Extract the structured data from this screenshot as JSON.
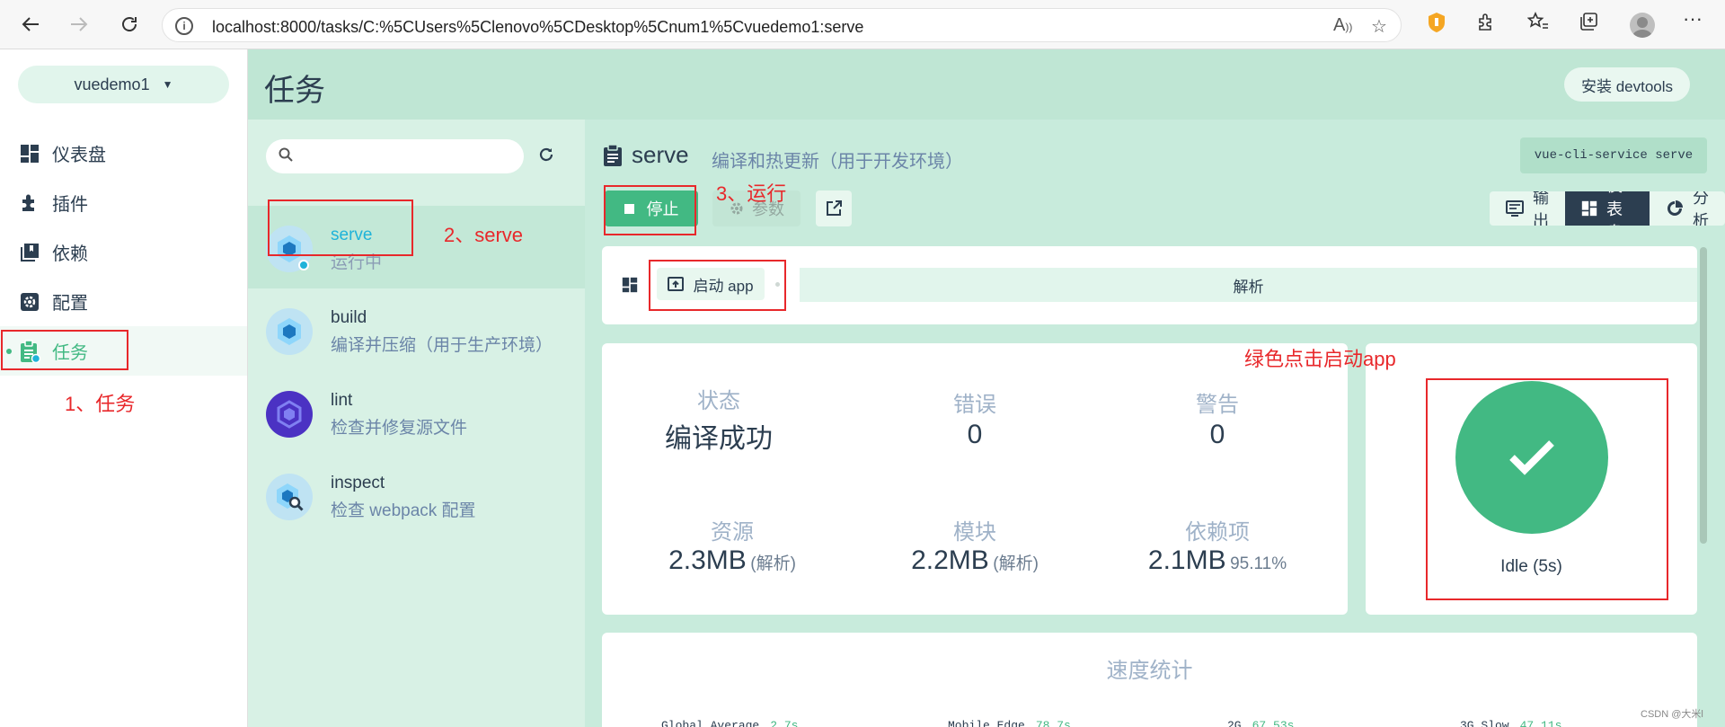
{
  "browser": {
    "url": "localhost:8000/tasks/C:%5CUsers%5Clenovo%5CDesktop%5Cnum1%5Cvuedemo1:serve"
  },
  "sidebar": {
    "project": "vuedemo1",
    "items": [
      {
        "label": "仪表盘",
        "icon": "dashboard-icon"
      },
      {
        "label": "插件",
        "icon": "puzzle-icon"
      },
      {
        "label": "依赖",
        "icon": "library-icon"
      },
      {
        "label": "配置",
        "icon": "gear-icon"
      },
      {
        "label": "任务",
        "icon": "clipboard-icon",
        "active": true
      }
    ]
  },
  "header": {
    "title": "任务",
    "devtools_button": "安装 devtools"
  },
  "task_list": {
    "search_placeholder": "",
    "tasks": [
      {
        "name": "serve",
        "description": "运行中",
        "selected": true
      },
      {
        "name": "build",
        "description": "编译并压缩（用于生产环境）"
      },
      {
        "name": "lint",
        "description": "检查并修复源文件"
      },
      {
        "name": "inspect",
        "description": "检查 webpack 配置"
      }
    ]
  },
  "detail": {
    "title": "serve",
    "description": "编译和热更新（用于开发环境）",
    "command": "vue-cli-service serve",
    "stop_button": "停止",
    "params_button": "参数",
    "tabs": [
      {
        "label": "输出",
        "icon": "terminal-icon"
      },
      {
        "label": "仪表盘",
        "icon": "dashboard-icon",
        "active": true
      },
      {
        "label": "分析",
        "icon": "pie-icon"
      }
    ],
    "launch_button": "启动 app",
    "analyze_label": "解析",
    "stats": {
      "status_label": "状态",
      "status_value": "编译成功",
      "errors_label": "错误",
      "errors_value": "0",
      "warnings_label": "警告",
      "warnings_value": "0",
      "assets_label": "资源",
      "assets_value": "2.3MB",
      "assets_sub": "(解析)",
      "modules_label": "模块",
      "modules_value": "2.2MB",
      "modules_sub": "(解析)",
      "deps_label": "依赖项",
      "deps_value": "2.1MB",
      "deps_sub": "95.11%"
    },
    "idle_status": "Idle (5s)",
    "speed_title": "速度统计",
    "speed": [
      {
        "label": "Global Average",
        "value": "2.7s"
      },
      {
        "label": "Mobile Edge",
        "value": "78.7s"
      },
      {
        "label": "2G",
        "value": "67.53s"
      },
      {
        "label": "3G Slow",
        "value": "47.11s"
      }
    ]
  },
  "annotations": {
    "a1": "1、任务",
    "a2": "2、serve",
    "a3": "3、运行",
    "a4": "绿色点击启动app"
  },
  "watermark": "CSDN @大米l",
  "colors": {
    "accent": "#42b983",
    "dark": "#2c3e50",
    "annotation": "#e8282b"
  }
}
